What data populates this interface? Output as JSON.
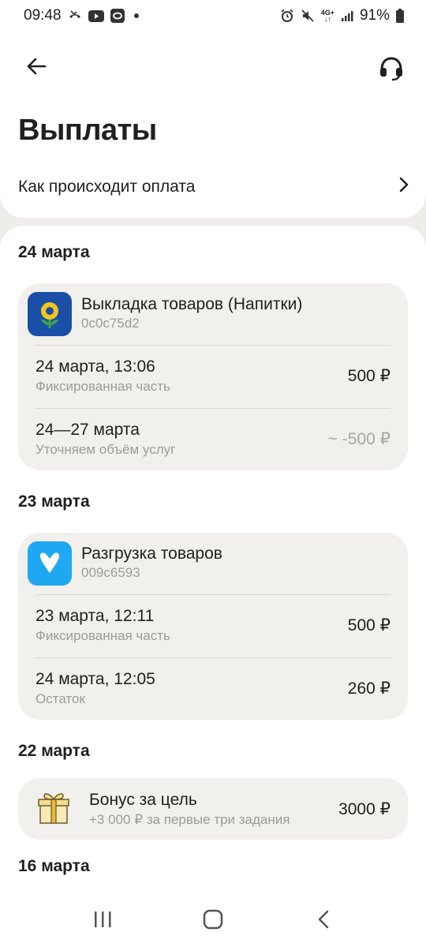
{
  "status_bar": {
    "time": "09:48",
    "network": "4G+",
    "battery": "91%",
    "left_icons": [
      "missed-call-icon",
      "youtube-icon",
      "app-icon",
      "dot-icon"
    ],
    "right_icons": [
      "alarm-icon",
      "mute-icon",
      "network-icon",
      "signal-icon",
      "battery-icon"
    ]
  },
  "header": {
    "title": "Выплаты",
    "back_icon": "arrow-left-icon",
    "support_icon": "headset-icon"
  },
  "how_payment": {
    "label": "Как происходит оплата",
    "icon": "chevron-right-icon"
  },
  "groups": [
    {
      "date": "24 марта",
      "task": {
        "name": "Выкладка товаров (Напитки)",
        "id": "0c0c75d2",
        "icon": "sunflower-icon",
        "icon_bg": "#1a4fa8",
        "payments": [
          {
            "when": "24 марта, 13:06",
            "desc": "Фиксированная часть",
            "amount": "500 ₽"
          },
          {
            "when": "24—27 марта",
            "desc": "Уточняем объём услуг",
            "amount": "~ -500 ₽"
          }
        ]
      }
    },
    {
      "date": "23 марта",
      "task": {
        "name": "Разгрузка товаров",
        "id": "009c6593",
        "icon": "heart-icon",
        "icon_bg": "#1fa8f2",
        "payments": [
          {
            "when": "23 марта, 12:11",
            "desc": "Фиксированная часть",
            "amount": "500 ₽"
          },
          {
            "when": "24 марта, 12:05",
            "desc": "Остаток",
            "amount": "260 ₽"
          }
        ]
      }
    },
    {
      "date": "22 марта",
      "bonus": {
        "title": "Бонус за цель",
        "sub": "+3 000 ₽ за первые три задания",
        "amount": "3000 ₽",
        "icon": "gift-icon"
      }
    },
    {
      "date": "16 марта"
    }
  ],
  "nav": {
    "recents_icon": "recents-icon",
    "home_icon": "home-icon",
    "back_icon": "back-icon"
  }
}
